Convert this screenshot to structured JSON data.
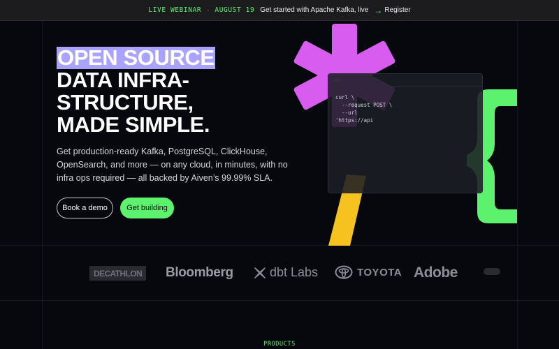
{
  "banner": {
    "tag": "LIVE WEBINAR",
    "separator": "·",
    "date": "AUGUST 19",
    "message": "Get started with Apache Kafka, live",
    "link_label": "Register"
  },
  "hero": {
    "headline_highlight": "OPEN SOURCE",
    "headline_lines": [
      "DATA INFRA-",
      "STRUCTURE,",
      "MADE SIMPLE."
    ],
    "description": "Get production-ready Kafka, PostgreSQL, ClickHouse, OpenSearch, and more — on any cloud, in minutes, with no infra ops required — all backed by Aiven’s 99.99% SLA.",
    "primary_cta": "Book a demo",
    "secondary_cta": "Get building"
  },
  "code_panel": {
    "lines": [
      "curl \\",
      "  --request POST \\",
      "  --url",
      "'https://api"
    ]
  },
  "logos": {
    "items": [
      "DECATHLON",
      "Bloomberg",
      "dbt Labs",
      "TOYOTA",
      "Adobe"
    ]
  },
  "section": {
    "label": "PRODUCTS"
  },
  "colors": {
    "accent_green": "#5cf26d",
    "highlight_purple": "#a9a3ff",
    "shape_magenta": "#d85cf0",
    "shape_yellow": "#f5c21f",
    "background": "#07080d"
  }
}
